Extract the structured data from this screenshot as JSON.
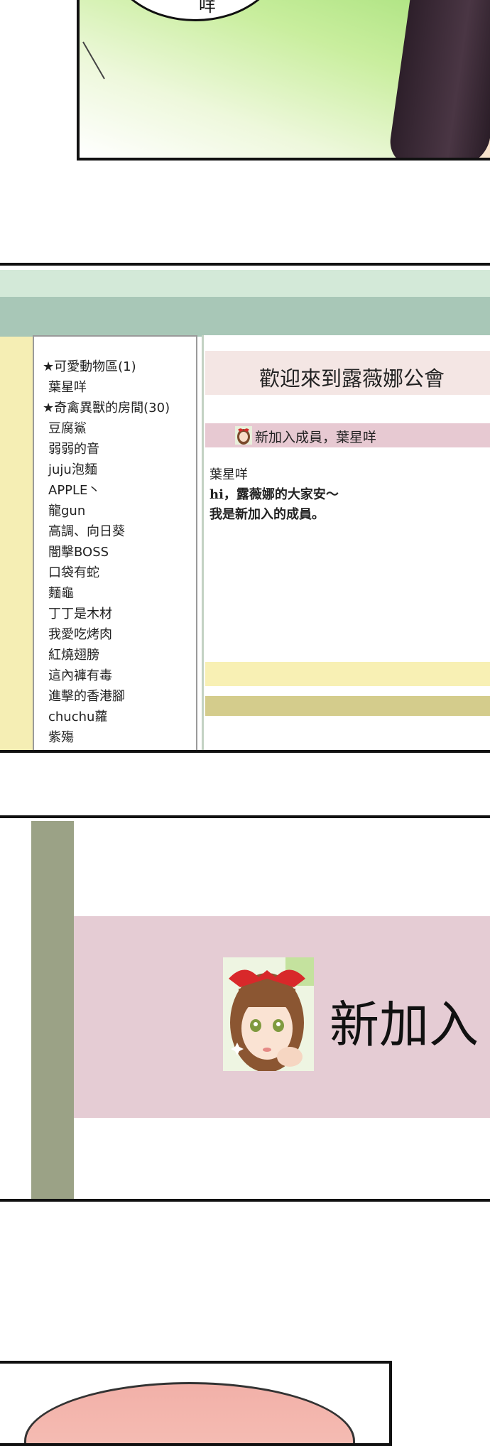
{
  "panel1": {
    "speech_glyph": "咩"
  },
  "sidebar": {
    "items": [
      {
        "label": "★可愛動物區(1)",
        "level": 0
      },
      {
        "label": "葉星咩",
        "level": 1
      },
      {
        "label": "★奇禽異獸的房間(30)",
        "level": 0
      },
      {
        "label": "豆腐鯊",
        "level": 1
      },
      {
        "label": "弱弱的音",
        "level": 1
      },
      {
        "label": "juju泡麵",
        "level": 1
      },
      {
        "label": "APPLE丶",
        "level": 1
      },
      {
        "label": "龍gun",
        "level": 1
      },
      {
        "label": "高調、向日葵",
        "level": 1
      },
      {
        "label": "闇擊BOSS",
        "level": 1
      },
      {
        "label": "口袋有蛇",
        "level": 1
      },
      {
        "label": "麵龜",
        "level": 1
      },
      {
        "label": "丁丁是木材",
        "level": 1
      },
      {
        "label": "我愛吃烤肉",
        "level": 1
      },
      {
        "label": "紅燒翅膀",
        "level": 1
      },
      {
        "label": "這內褲有毒",
        "level": 1
      },
      {
        "label": "進擊的香港腳",
        "level": 1
      },
      {
        "label": "chuchu蘿",
        "level": 1
      },
      {
        "label": "紫殤",
        "level": 1
      }
    ]
  },
  "main": {
    "welcome": "歡迎來到露薇娜公會",
    "new_member_banner": "新加入成員，葉星咩",
    "post": {
      "author": "葉星咩",
      "line1": "hi，露薇娜的大家安～",
      "line2": "我是新加入的成員。"
    }
  },
  "closeup": {
    "heading": "新加入"
  },
  "colors": {
    "stripe_light": "#d3e9d8",
    "stripe_dark": "#a8c7b7",
    "sidebar_band": "#f5eeb4",
    "welcome_bg": "#f4e6e4",
    "banner_pink": "#e7c9d2",
    "footer_yellow": "#f8f0b4",
    "footer_olive": "#d4cc8c",
    "closeup_pink": "#e5ccd4",
    "closeup_olive": "#9ba286"
  }
}
